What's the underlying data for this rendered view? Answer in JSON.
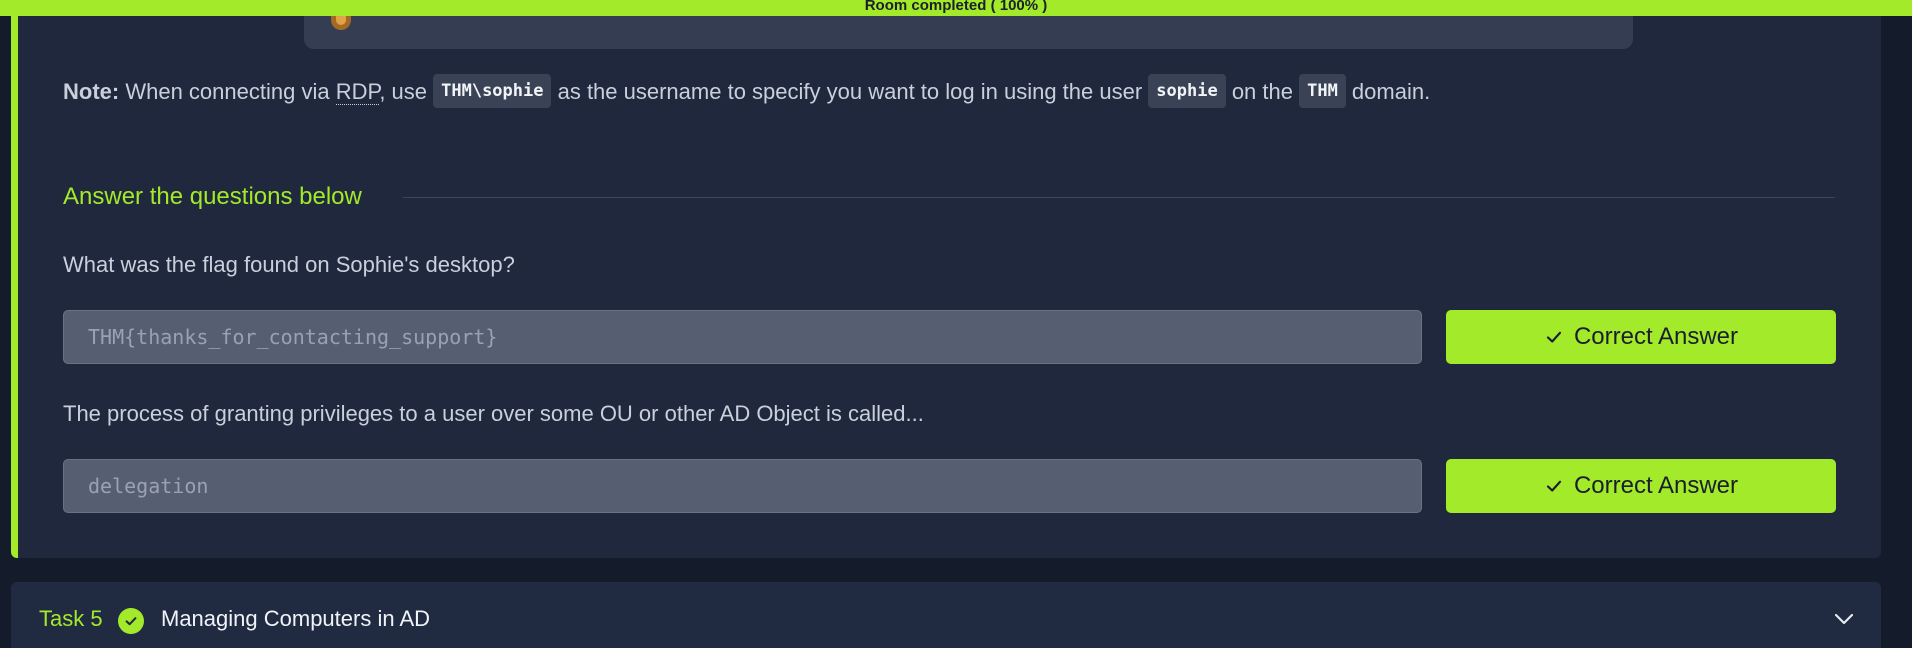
{
  "progress": {
    "label": "Room completed ( 100% )",
    "percent": 100,
    "color": "#a3ea2a"
  },
  "note": {
    "label": "Note:",
    "t1": " When connecting via ",
    "abbr": "RDP",
    "t2": ", use ",
    "code1": "THM\\sophie",
    "t3": " as the username to specify you want to log in using the user ",
    "code2": "sophie",
    "t4": " on the ",
    "code3": "THM",
    "t5": " domain."
  },
  "questions_section": {
    "heading": "Answer the questions below",
    "items": [
      {
        "question": "What was the flag found on Sophie's desktop?",
        "answer": "THM{thanks_for_contacting_support}",
        "button": "Correct Answer"
      },
      {
        "question": "The process of granting privileges to a user over some OU or other AD Object is called...",
        "answer": "delegation",
        "button": "Correct Answer"
      }
    ]
  },
  "next_task": {
    "number": "Task 5",
    "title": "Managing Computers in AD",
    "status_icon": "check-circle-icon",
    "toggle_icon": "chevron-down-icon"
  },
  "colors": {
    "accent": "#a3ea2a",
    "panel": "#1f283d",
    "background": "#141c2b"
  }
}
